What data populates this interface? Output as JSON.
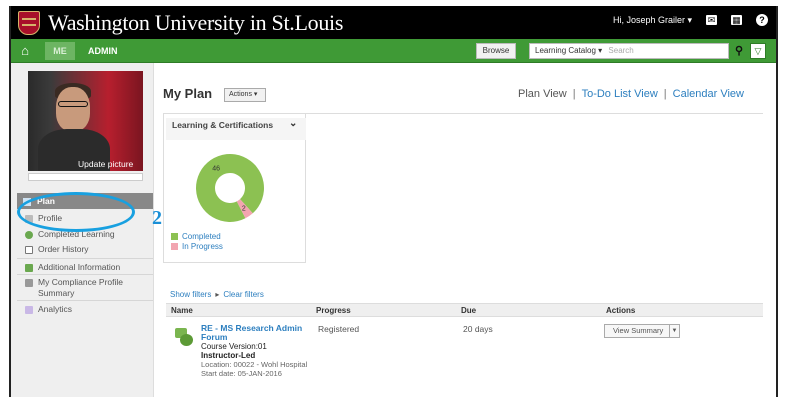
{
  "header": {
    "title": "Washington University in St.Louis",
    "user": "Hi, Joseph Grailer ▾"
  },
  "nav": {
    "me": "ME",
    "admin": "ADMIN",
    "browse": "Browse",
    "catalog": "Learning Catalog ▾",
    "search_placeholder": "Search"
  },
  "sidebar": {
    "update_picture": "Update picture",
    "items": [
      {
        "label": "Plan"
      },
      {
        "label": "Profile"
      },
      {
        "label": "Completed Learning"
      },
      {
        "label": "Order History"
      },
      {
        "label": "Additional Information"
      },
      {
        "label": "My Compliance Profile Summary"
      },
      {
        "label": "Analytics"
      }
    ]
  },
  "annotation": {
    "number": "2"
  },
  "main": {
    "title": "My Plan",
    "actions": "Actions ▾",
    "views": [
      "Plan View",
      "To-Do List View",
      "Calendar View"
    ],
    "panel_title": "Learning & Certifications",
    "legend": [
      "Completed",
      "In Progress"
    ],
    "filters": [
      "Show filters",
      "Clear filters"
    ],
    "table": {
      "columns": [
        "Name",
        "Progress",
        "Due",
        "Actions"
      ],
      "rows": [
        {
          "title": "RE - MS Research Admin Forum",
          "type_line": "Course  Version:01",
          "delivery": "Instructor-Led",
          "location": "Location: 00022 - Wohl Hospital",
          "start": "Start date: 05-JAN-2016",
          "progress": "Registered",
          "due": "20 days",
          "action": "View Summary"
        }
      ]
    }
  },
  "chart_data": {
    "type": "pie",
    "series": [
      {
        "name": "Completed",
        "value": 46,
        "label": "46"
      },
      {
        "name": "In Progress",
        "value": 2,
        "label": "2"
      }
    ],
    "colors": {
      "Completed": "#8cc152",
      "In Progress": "#f2a5b0"
    }
  },
  "colors": {
    "nav_green": "#3f9a36",
    "link_blue": "#2d7fbf",
    "annotation_blue": "#18a0e0"
  }
}
